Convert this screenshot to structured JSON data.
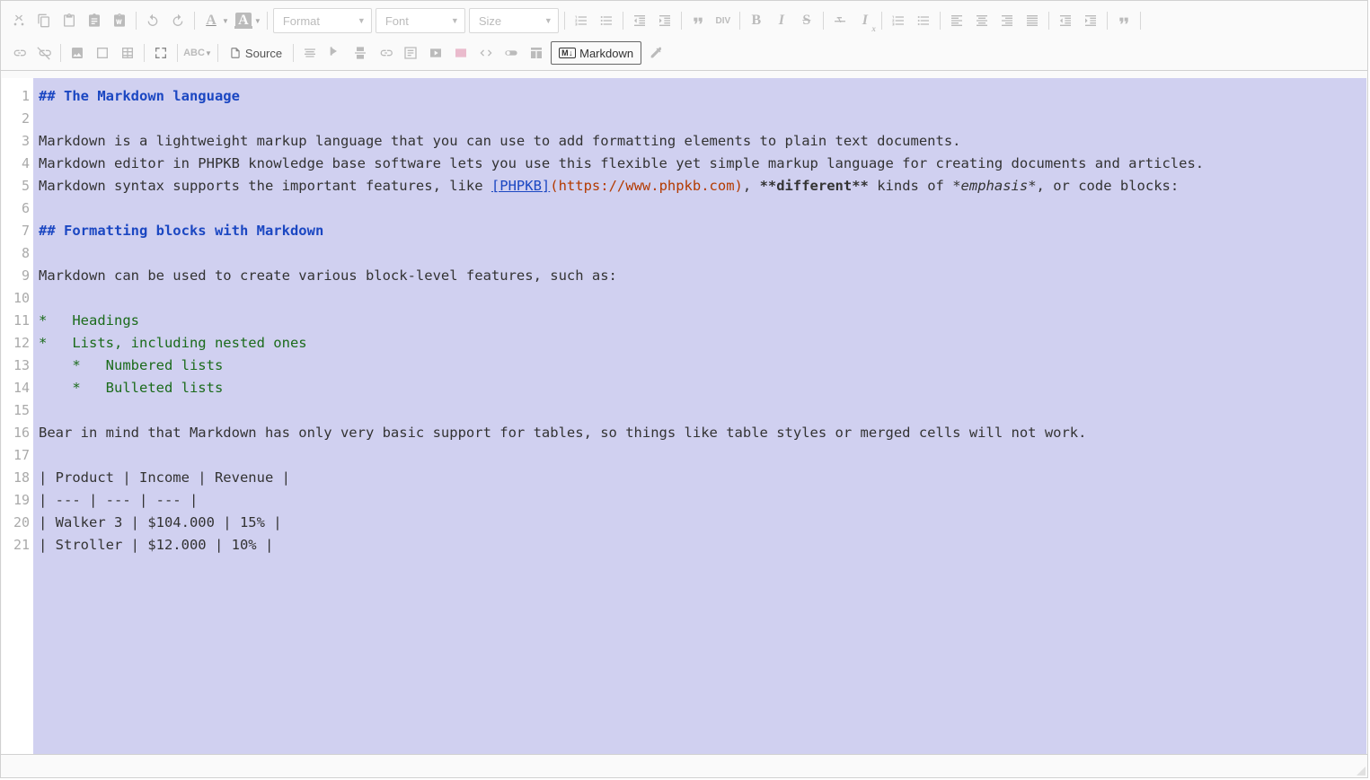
{
  "toolbar": {
    "format_label": "Format",
    "font_label": "Font",
    "size_label": "Size",
    "source_label": "Source",
    "markdown_label": "Markdown",
    "markdown_badge": "M↓"
  },
  "code_lines": [
    {
      "n": 1,
      "segs": [
        {
          "t": "## The Markdown language",
          "c": "h"
        }
      ]
    },
    {
      "n": 2,
      "segs": [
        {
          "t": " ",
          "c": ""
        }
      ]
    },
    {
      "n": 3,
      "segs": [
        {
          "t": "Markdown is a lightweight markup language that you can use to add formatting elements to plain text documents.",
          "c": ""
        }
      ]
    },
    {
      "n": 4,
      "segs": [
        {
          "t": "Markdown editor in PHPKB knowledge base software lets you use this flexible yet simple markup language for creating documents and articles.",
          "c": ""
        }
      ]
    },
    {
      "n": 5,
      "segs": [
        {
          "t": "Markdown syntax supports the important features, like ",
          "c": ""
        },
        {
          "t": "[PHPKB]",
          "c": "lk"
        },
        {
          "t": "(https://www.phpkb.com)",
          "c": "url"
        },
        {
          "t": ", ",
          "c": ""
        },
        {
          "t": "**different**",
          "c": "bold"
        },
        {
          "t": " kinds of ",
          "c": ""
        },
        {
          "t": "*emphasis*",
          "c": "ital"
        },
        {
          "t": ", or code blocks:",
          "c": ""
        }
      ]
    },
    {
      "n": 6,
      "segs": [
        {
          "t": " ",
          "c": ""
        }
      ]
    },
    {
      "n": 7,
      "segs": [
        {
          "t": "## Formatting blocks with Markdown",
          "c": "h"
        }
      ]
    },
    {
      "n": 8,
      "segs": [
        {
          "t": " ",
          "c": ""
        }
      ]
    },
    {
      "n": 9,
      "segs": [
        {
          "t": "Markdown can be used to create various block-level features, such as:",
          "c": ""
        }
      ]
    },
    {
      "n": 10,
      "segs": [
        {
          "t": " ",
          "c": ""
        }
      ]
    },
    {
      "n": 11,
      "segs": [
        {
          "t": "*   Headings",
          "c": "li"
        }
      ]
    },
    {
      "n": 12,
      "segs": [
        {
          "t": "*   Lists, including nested ones",
          "c": "li"
        }
      ]
    },
    {
      "n": 13,
      "segs": [
        {
          "t": "    *   Numbered lists",
          "c": "nest"
        }
      ]
    },
    {
      "n": 14,
      "segs": [
        {
          "t": "    *   Bulleted lists",
          "c": "nest"
        }
      ]
    },
    {
      "n": 15,
      "segs": [
        {
          "t": " ",
          "c": ""
        }
      ]
    },
    {
      "n": 16,
      "segs": [
        {
          "t": "Bear in mind that Markdown has only very basic support for tables, so things like table styles or merged cells will not work.",
          "c": ""
        }
      ]
    },
    {
      "n": 17,
      "segs": [
        {
          "t": " ",
          "c": ""
        }
      ]
    },
    {
      "n": 18,
      "segs": [
        {
          "t": "| Product | Income | Revenue |",
          "c": ""
        }
      ]
    },
    {
      "n": 19,
      "segs": [
        {
          "t": "| --- | --- | --- |",
          "c": ""
        }
      ]
    },
    {
      "n": 20,
      "segs": [
        {
          "t": "| Walker 3 | $104.000 | 15% |",
          "c": ""
        }
      ]
    },
    {
      "n": 21,
      "segs": [
        {
          "t": "| Stroller | $12.000 | 10% |",
          "c": ""
        }
      ]
    }
  ]
}
